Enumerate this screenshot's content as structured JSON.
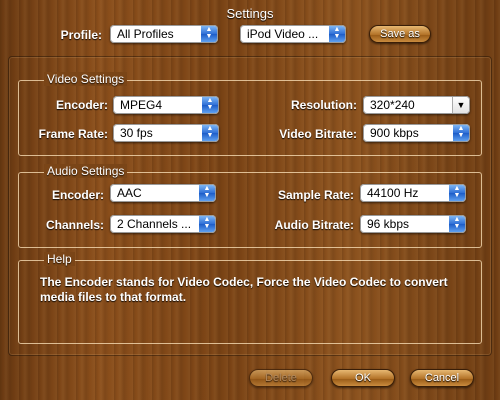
{
  "window": {
    "title": "Settings"
  },
  "profile": {
    "label": "Profile:",
    "category_value": "All Profiles",
    "profile_value": "iPod Video ...",
    "save_as_label": "Save as"
  },
  "video": {
    "legend": "Video Settings",
    "encoder_label": "Encoder:",
    "encoder_value": "MPEG4",
    "frame_rate_label": "Frame Rate:",
    "frame_rate_value": "30 fps",
    "resolution_label": "Resolution:",
    "resolution_value": "320*240",
    "bitrate_label": "Video Bitrate:",
    "bitrate_value": "900 kbps"
  },
  "audio": {
    "legend": "Audio Settings",
    "encoder_label": "Encoder:",
    "encoder_value": "AAC",
    "channels_label": "Channels:",
    "channels_value": "2 Channels ...",
    "sample_rate_label": "Sample Rate:",
    "sample_rate_value": "44100 Hz",
    "bitrate_label": "Audio Bitrate:",
    "bitrate_value": "96 kbps"
  },
  "help": {
    "legend": "Help",
    "text": "The Encoder stands for Video Codec, Force the Video Codec to convert media files to that format."
  },
  "buttons": {
    "delete": "Delete",
    "ok": "OK",
    "cancel": "Cancel"
  },
  "colors": {
    "wood": "#7a4315",
    "accent": "#2e6fd6"
  }
}
